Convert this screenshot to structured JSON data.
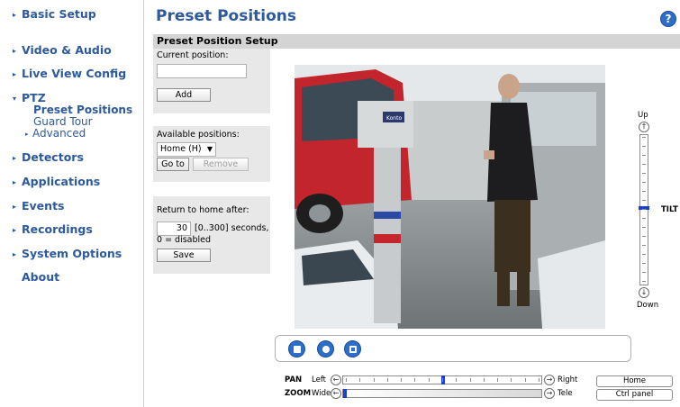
{
  "sidebar": {
    "items": [
      {
        "label": "Basic Setup"
      },
      {
        "label": "Video & Audio"
      },
      {
        "label": "Live View Config"
      },
      {
        "label": "PTZ"
      },
      {
        "label": "Detectors"
      },
      {
        "label": "Applications"
      },
      {
        "label": "Events"
      },
      {
        "label": "Recordings"
      },
      {
        "label": "System Options"
      },
      {
        "label": "About"
      }
    ],
    "ptz_sub": [
      {
        "label": "Preset Positions"
      },
      {
        "label": "Guard Tour"
      },
      {
        "label": "Advanced"
      }
    ]
  },
  "header": {
    "title": "Preset Positions",
    "help": "?"
  },
  "section": {
    "title": "Preset Position Setup"
  },
  "current_position": {
    "label": "Current position:",
    "value": "",
    "add_label": "Add"
  },
  "available": {
    "label": "Available positions:",
    "selected": "Home (H)",
    "goto_label": "Go to",
    "remove_label": "Remove"
  },
  "return_home": {
    "label": "Return to home after:",
    "value": "30",
    "range": "[0..300] seconds,",
    "note": "0 = disabled",
    "save_label": "Save"
  },
  "tilt": {
    "up": "Up",
    "down": "Down",
    "label": "TILT",
    "level": 0.48
  },
  "pan": {
    "label": "PAN",
    "left": "Left",
    "right": "Right",
    "level": 0.5
  },
  "zoom": {
    "label": "ZOOM",
    "wide": "Wide",
    "tele": "Tele",
    "level": 0.0
  },
  "buttons": {
    "home": "Home",
    "ctrl_panel": "Ctrl panel"
  },
  "video": {
    "sign": "Konto"
  },
  "colors": {
    "accent": "#2d5a9c",
    "slider_thumb": "#1a3fd1",
    "panel": "#e8e8e8"
  }
}
